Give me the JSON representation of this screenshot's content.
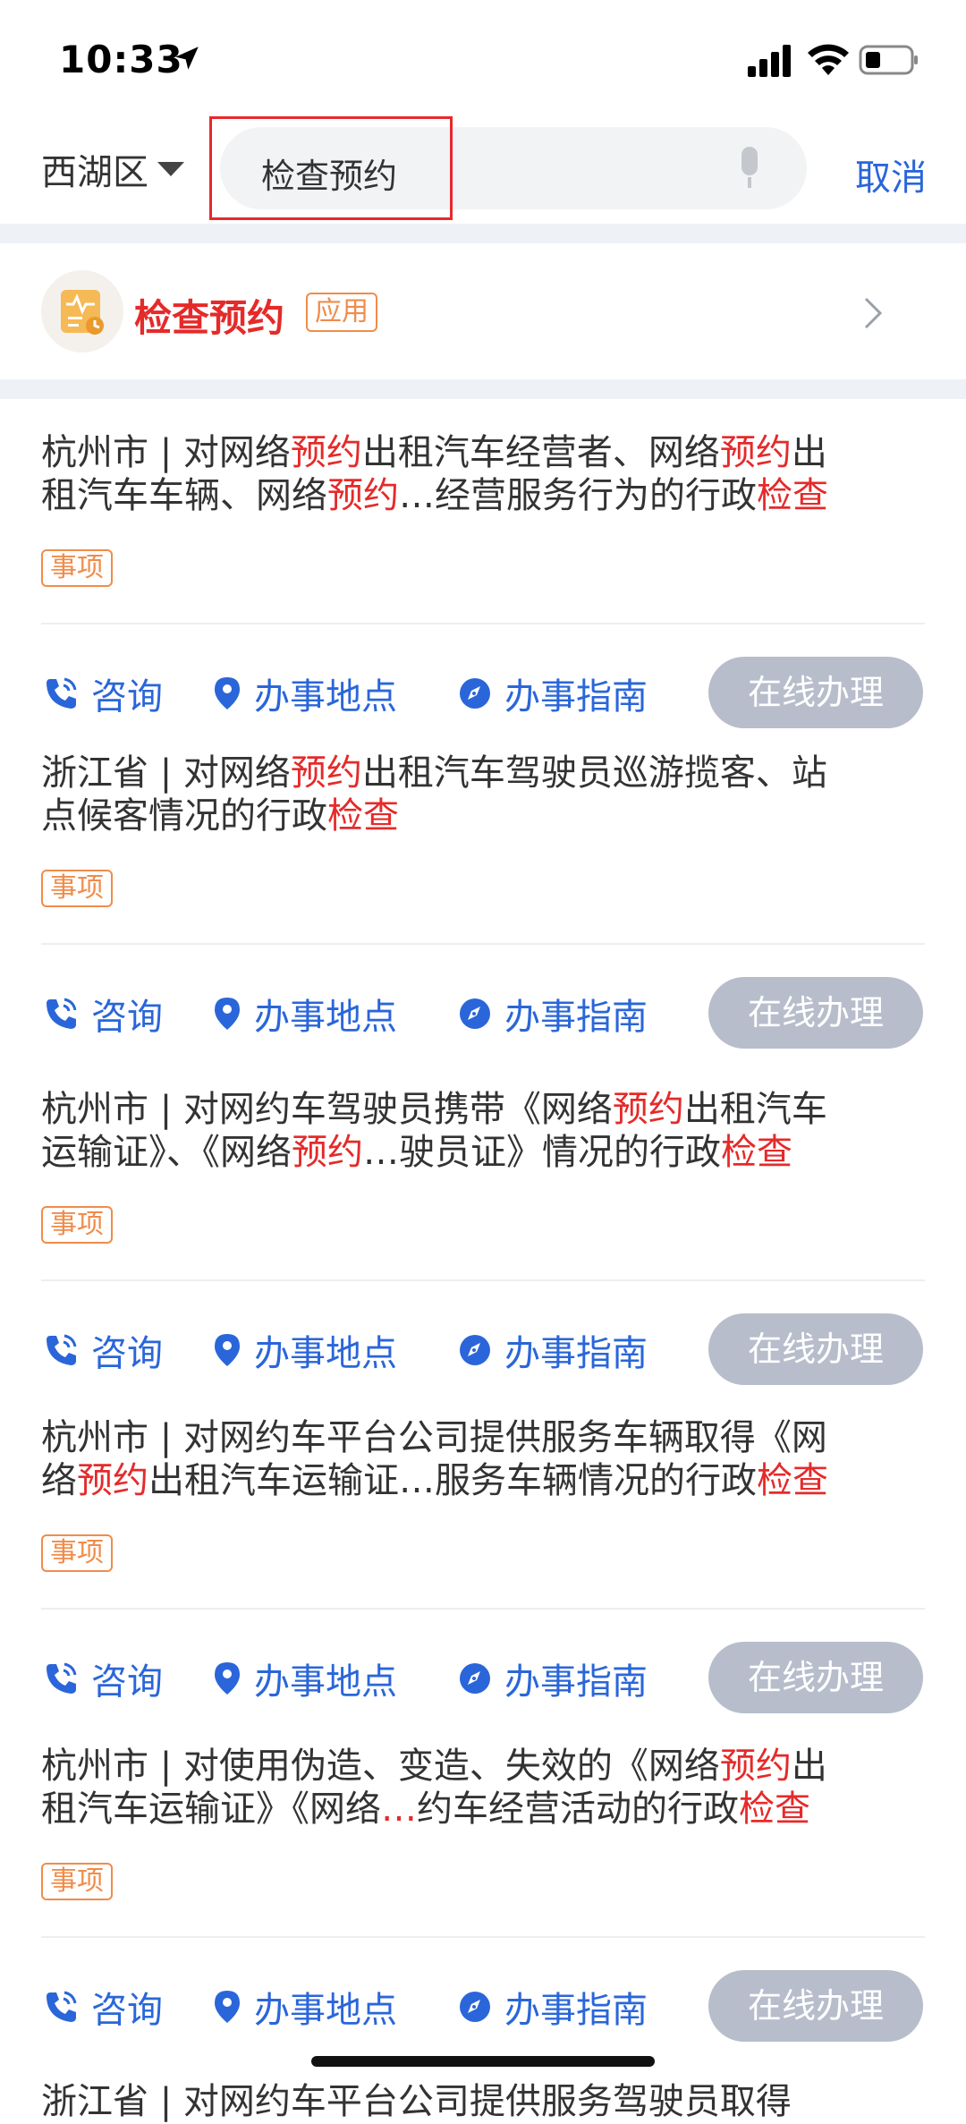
{
  "status_bar": {
    "time": "10:33"
  },
  "header": {
    "region": "西湖区",
    "search_value": "检查预约",
    "cancel": "取消"
  },
  "app_result": {
    "name": "检查预约",
    "badge": "应用"
  },
  "actions": {
    "consult": "咨询",
    "place": "办事地点",
    "guide": "办事指南",
    "online": "在线办理"
  },
  "tag_label": "事项",
  "results": [
    {
      "line1": [
        "杭州市 | 对网络",
        "预约",
        "出租汽车经营者、网络",
        "预约",
        "出"
      ],
      "line2": [
        "租汽车车辆、网络",
        "预约",
        "…经营服务行为的行政",
        "检查"
      ]
    },
    {
      "line1": [
        "浙江省 | 对网络",
        "预约",
        "出租汽车驾驶员巡游揽客、站"
      ],
      "line2": [
        "点候客情况的行政",
        "检查"
      ]
    },
    {
      "line1": [
        "杭州市 | 对网约车驾驶员携带《网络",
        "预约",
        "出租汽车"
      ],
      "line2": [
        "运输证》、《网络",
        "预约",
        "…驶员证》情况的行政",
        "检查"
      ]
    },
    {
      "line1": [
        "杭州市 | 对网约车平台公司提供服务车辆取得《网"
      ],
      "line2": [
        "络",
        "预约",
        "出租汽车运输证…服务车辆情况的行政",
        "检查"
      ]
    },
    {
      "line1": [
        "杭州市 | 对使用伪造、变造、失效的《网络",
        "预约",
        "出"
      ],
      "line2": [
        "租汽车运输证》《网络",
        "…",
        "约车经营活动的行政",
        "检查"
      ]
    }
  ],
  "partial_next": "浙江省 | 对网约车平台公司提供服务驾驶员取得",
  "colors": {
    "accent": "#2a66d9",
    "highlight": "#e52a2a",
    "tag": "#f08c4a",
    "button_disabled": "#b7bdcb"
  }
}
